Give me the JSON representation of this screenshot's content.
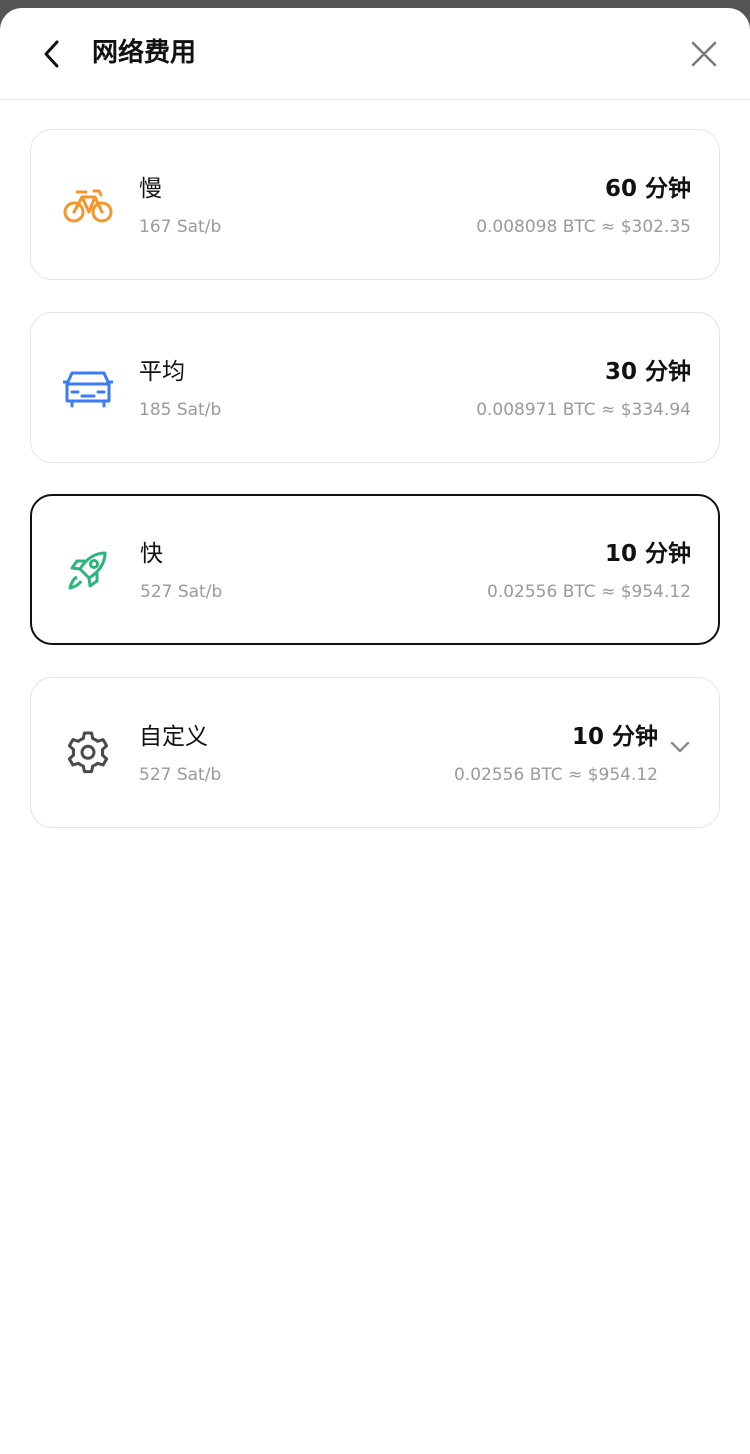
{
  "header": {
    "title": "网络费用",
    "back_icon": "chevron-left-icon",
    "close_icon": "close-icon"
  },
  "options": [
    {
      "id": "slow",
      "name": "慢",
      "rate": "167 Sat/b",
      "time": "60 分钟",
      "cost": "0.008098 BTC ≈ $302.35",
      "icon": "bicycle-icon",
      "icon_color": "#f5962a",
      "selected": false
    },
    {
      "id": "average",
      "name": "平均",
      "rate": "185 Sat/b",
      "time": "30 分钟",
      "cost": "0.008971 BTC ≈ $334.94",
      "icon": "car-icon",
      "icon_color": "#3b7bf5",
      "selected": false
    },
    {
      "id": "fast",
      "name": "快",
      "rate": "527 Sat/b",
      "time": "10 分钟",
      "cost": "0.02556 BTC ≈ $954.12",
      "icon": "rocket-icon",
      "icon_color": "#2bb57a",
      "selected": true
    },
    {
      "id": "custom",
      "name": "自定义",
      "rate": "527 Sat/b",
      "time": "10 分钟",
      "cost": "0.02556 BTC ≈ $954.12",
      "icon": "gear-icon",
      "icon_color": "#4a4a4a",
      "selected": false,
      "expand_icon": "chevron-down-icon"
    }
  ]
}
